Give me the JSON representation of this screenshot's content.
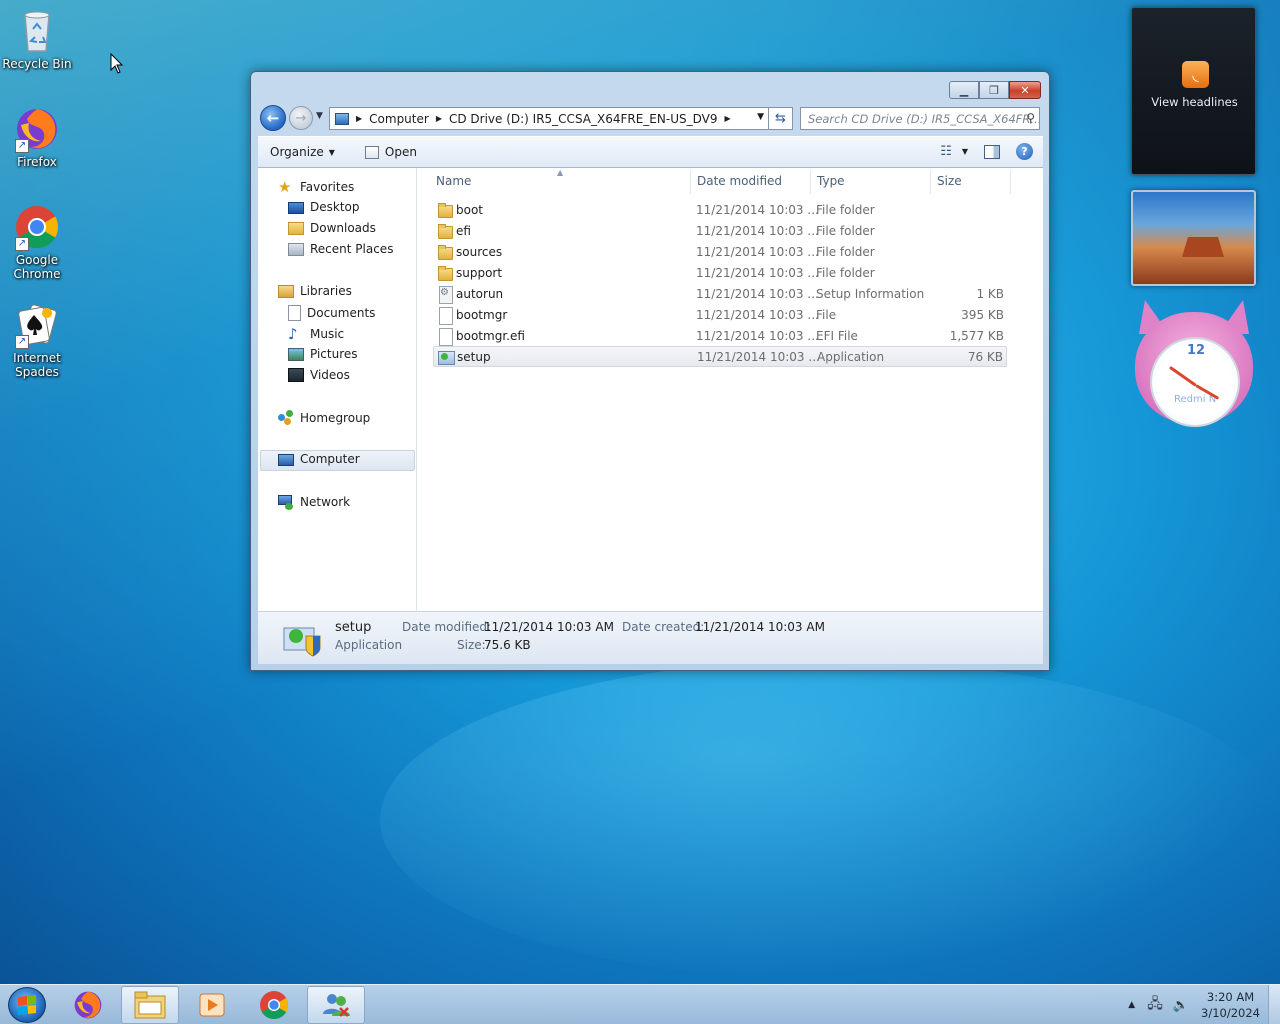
{
  "desktop": {
    "icons": [
      {
        "label": "Recycle Bin"
      },
      {
        "label": "Firefox"
      },
      {
        "label": "Google Chrome"
      },
      {
        "label": "Internet Spades"
      }
    ]
  },
  "window": {
    "address": {
      "crumbs": [
        "Computer",
        "CD Drive (D:) IR5_CCSA_X64FRE_EN-US_DV9"
      ]
    },
    "search_placeholder": "Search CD Drive (D:) IR5_CCSA_X64FR...",
    "toolbar": {
      "organize": "Organize",
      "open": "Open"
    },
    "nav": {
      "favorites": "Favorites",
      "desktop": "Desktop",
      "downloads": "Downloads",
      "recent_places": "Recent Places",
      "libraries": "Libraries",
      "documents": "Documents",
      "music": "Music",
      "pictures": "Pictures",
      "videos": "Videos",
      "homegroup": "Homegroup",
      "computer": "Computer",
      "network": "Network"
    },
    "columns": {
      "name": "Name",
      "date_modified": "Date modified",
      "type": "Type",
      "size": "Size"
    },
    "files": [
      {
        "name": "boot",
        "date": "11/21/2014 10:03 ...",
        "type": "File folder",
        "size": "",
        "icon": "folder-icon"
      },
      {
        "name": "efi",
        "date": "11/21/2014 10:03 ...",
        "type": "File folder",
        "size": "",
        "icon": "folder-icon"
      },
      {
        "name": "sources",
        "date": "11/21/2014 10:03 ...",
        "type": "File folder",
        "size": "",
        "icon": "folder-icon"
      },
      {
        "name": "support",
        "date": "11/21/2014 10:03 ...",
        "type": "File folder",
        "size": "",
        "icon": "folder-icon"
      },
      {
        "name": "autorun",
        "date": "11/21/2014 10:03 ...",
        "type": "Setup Information",
        "size": "1 KB",
        "icon": "setup-info-icon"
      },
      {
        "name": "bootmgr",
        "date": "11/21/2014 10:03 ...",
        "type": "File",
        "size": "395 KB",
        "icon": "file-icon"
      },
      {
        "name": "bootmgr.efi",
        "date": "11/21/2014 10:03 ...",
        "type": "EFI File",
        "size": "1,577 KB",
        "icon": "file-icon"
      },
      {
        "name": "setup",
        "date": "11/21/2014 10:03 ...",
        "type": "Application",
        "size": "76 KB",
        "icon": "application-icon"
      }
    ],
    "details": {
      "name": "setup",
      "type": "Application",
      "date_modified_label": "Date modified:",
      "date_modified": "11/21/2014 10:03 AM",
      "date_created_label": "Date created:",
      "date_created": "11/21/2014 10:03 AM",
      "size_label": "Size:",
      "size": "75.6 KB"
    }
  },
  "gadgets": {
    "news_label": "View headlines",
    "clock_number": "12",
    "clock_brand": "Redmi N"
  },
  "taskbar": {
    "time": "3:20 AM",
    "date": "3/10/2024"
  }
}
